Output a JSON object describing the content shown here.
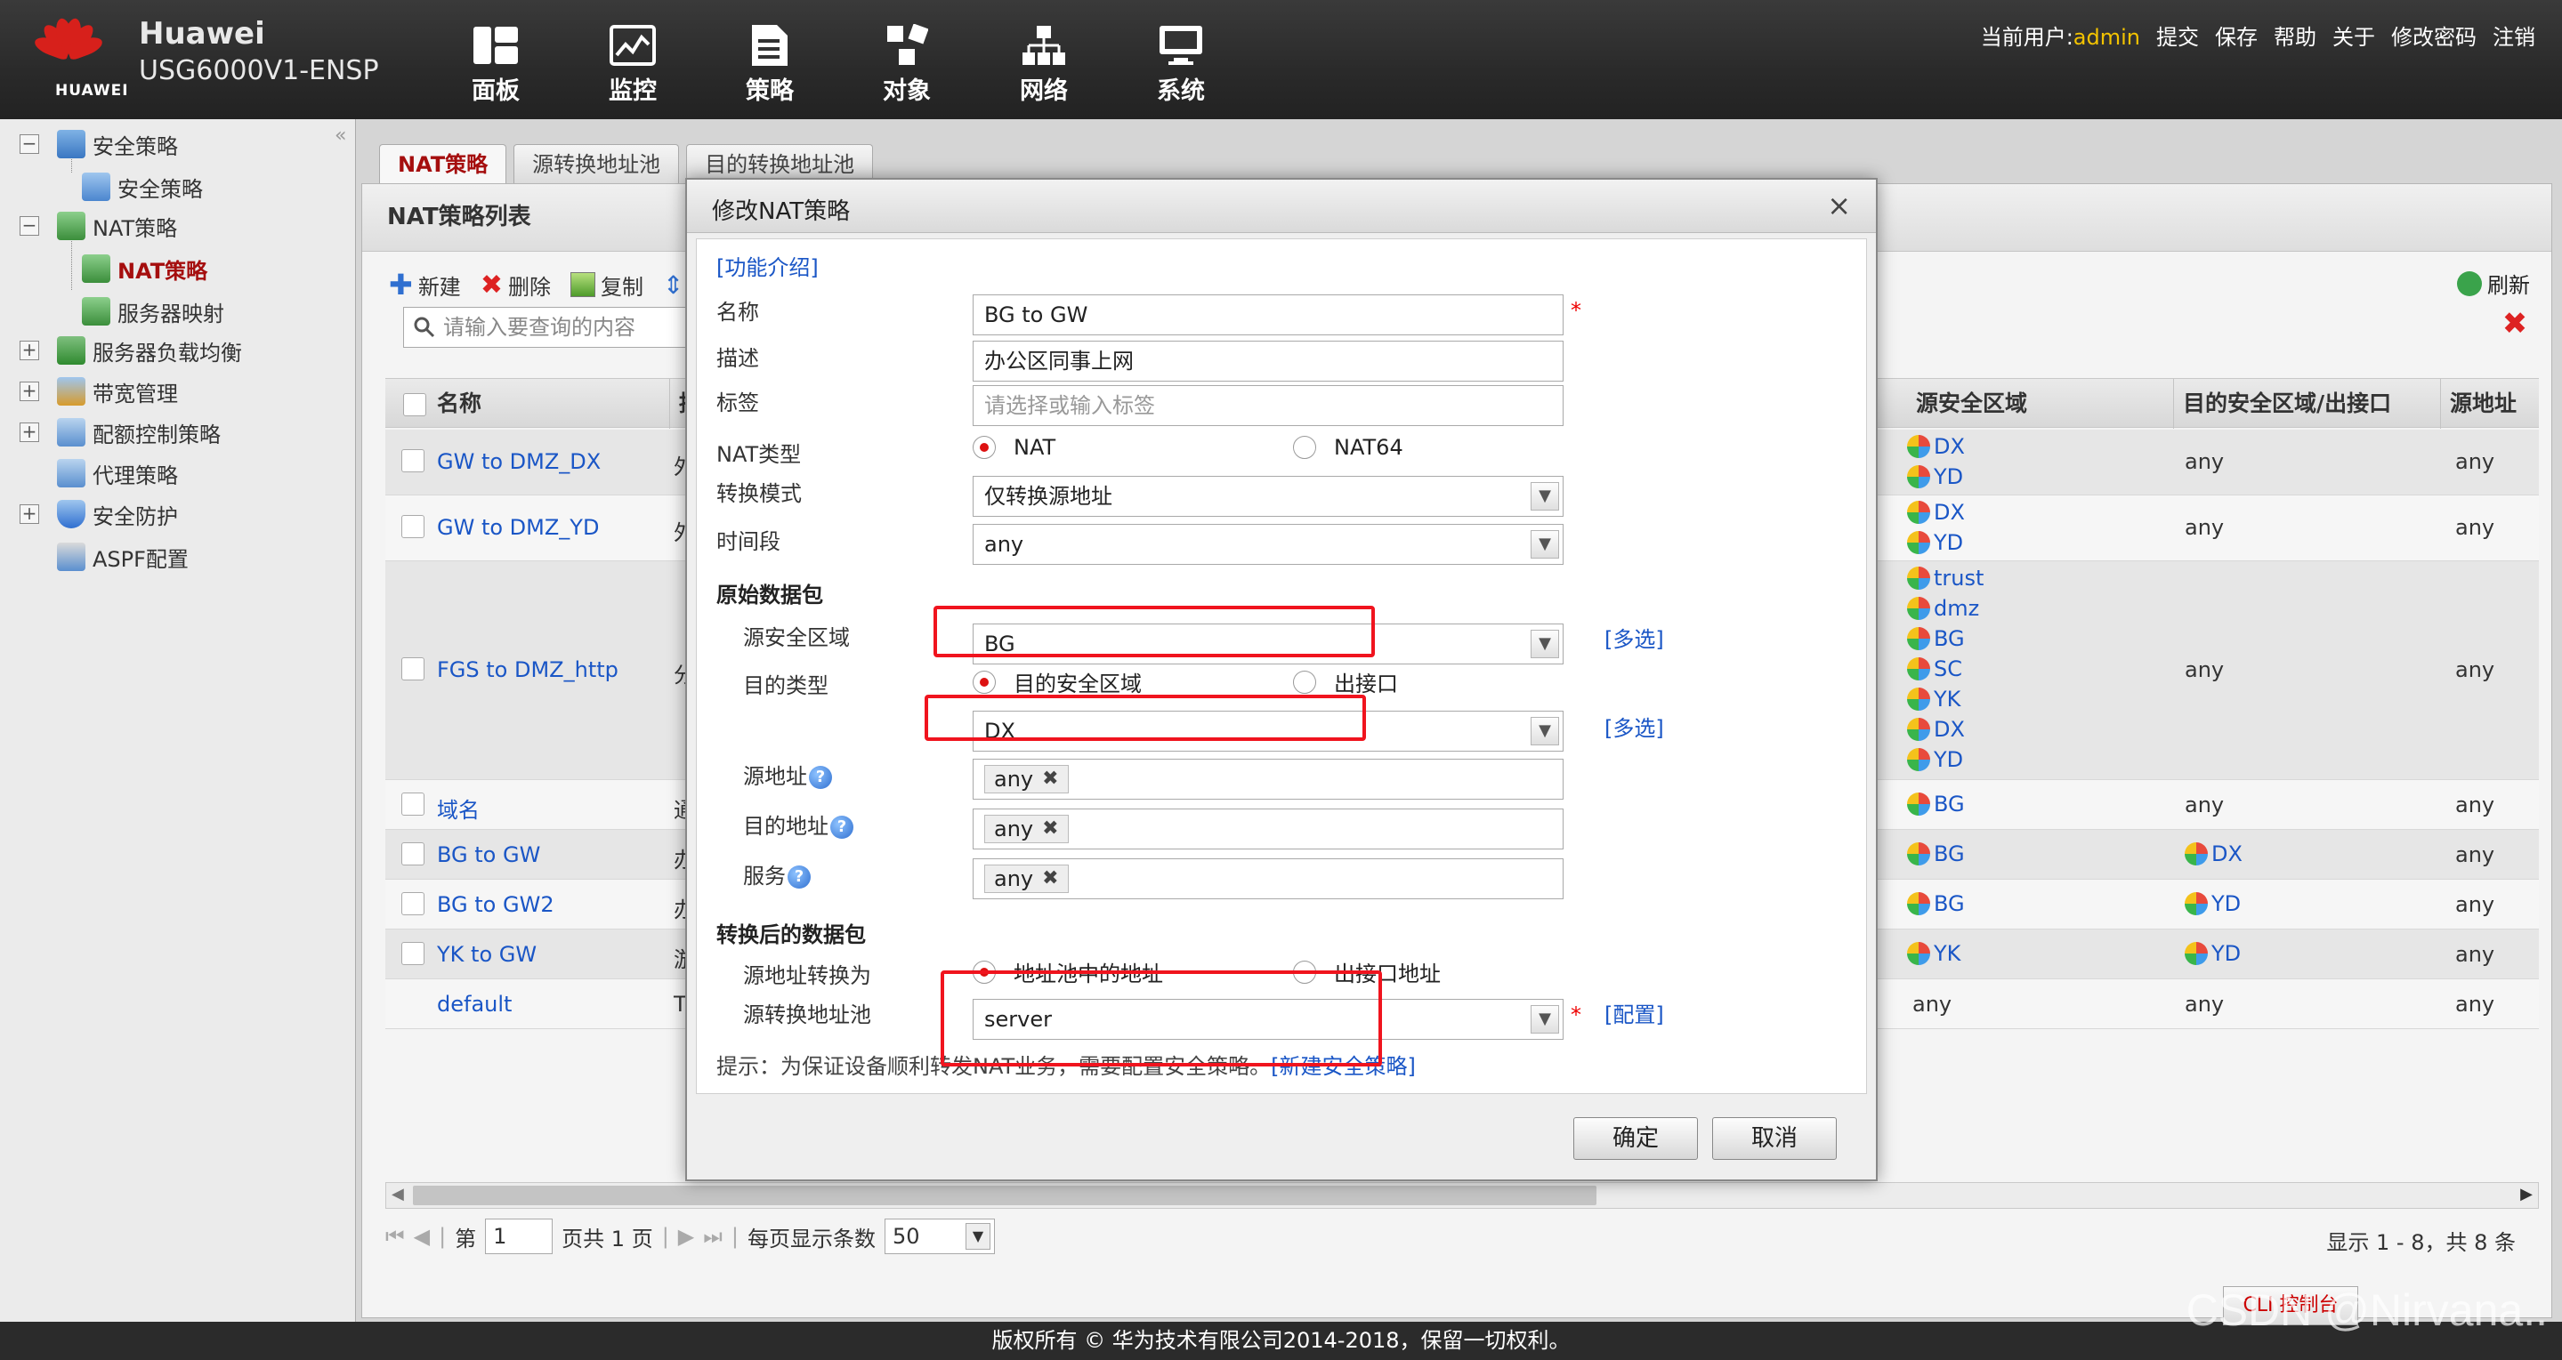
{
  "header": {
    "logo_text": "HUAWEI",
    "brand_name": "Huawei",
    "device_model": "USG6000V1-ENSP",
    "nav": [
      {
        "label": "面板",
        "icon": "dashboard-icon"
      },
      {
        "label": "监控",
        "icon": "monitor-icon"
      },
      {
        "label": "策略",
        "icon": "policy-icon"
      },
      {
        "label": "对象",
        "icon": "object-icon"
      },
      {
        "label": "网络",
        "icon": "network-icon"
      },
      {
        "label": "系统",
        "icon": "system-icon"
      }
    ],
    "user_prefix": "当前用户:",
    "user_name": "admin",
    "actions": [
      "提交",
      "保存",
      "帮助",
      "关于",
      "修改密码",
      "注销"
    ]
  },
  "sidebar": {
    "items": [
      {
        "label": "安全策略",
        "level": 0,
        "toggle": "−"
      },
      {
        "label": "安全策略",
        "level": 1
      },
      {
        "label": "NAT策略",
        "level": 0,
        "toggle": "−"
      },
      {
        "label": "NAT策略",
        "level": 1,
        "active": true
      },
      {
        "label": "服务器映射",
        "level": 1
      },
      {
        "label": "服务器负载均衡",
        "level": 0,
        "toggle": "+"
      },
      {
        "label": "带宽管理",
        "level": 0,
        "toggle": "+"
      },
      {
        "label": "配额控制策略",
        "level": 0,
        "toggle": "+"
      },
      {
        "label": "代理策略",
        "level": 0
      },
      {
        "label": "安全防护",
        "level": 0,
        "toggle": "+"
      },
      {
        "label": "ASPF配置",
        "level": 0
      }
    ]
  },
  "tabs": [
    {
      "label": "NAT策略",
      "active": true
    },
    {
      "label": "源转换地址池"
    },
    {
      "label": "目的转换地址池"
    }
  ],
  "panel": {
    "title": "NAT策略列表",
    "toolbar": {
      "new": "新建",
      "delete": "删除",
      "copy": "复制",
      "more": "移"
    },
    "refresh": "刷新",
    "search_placeholder": "请输入要查询的内容"
  },
  "table": {
    "headers": {
      "name": "名称",
      "desc": "描",
      "src_zone": "源安全区域",
      "dst_zone": "目的安全区域/出接口",
      "src_addr": "源地址"
    },
    "rows": [
      {
        "name": "GW to DMZ_DX",
        "desc": "外",
        "src_zones": [
          "DX",
          "YD"
        ],
        "dst": "any",
        "src_addr": "any"
      },
      {
        "name": "GW to DMZ_YD",
        "desc": "外",
        "src_zones": [
          "DX",
          "YD"
        ],
        "dst": "any",
        "src_addr": "any"
      },
      {
        "name": "FGS to DMZ_http",
        "desc": "分",
        "src_zones": [
          "trust",
          "dmz",
          "BG",
          "SC",
          "YK",
          "DX",
          "YD"
        ],
        "dst": "any",
        "src_addr": "any"
      },
      {
        "name": "域名",
        "desc": "通",
        "src_zones": [
          "BG"
        ],
        "dst": "any",
        "src_addr": "any"
      },
      {
        "name": "BG to GW",
        "desc": "办",
        "src_zones": [
          "BG"
        ],
        "dst_zone": "DX",
        "src_addr": "any"
      },
      {
        "name": "BG to GW2",
        "desc": "办",
        "src_zones": [
          "BG"
        ],
        "dst_zone": "YD",
        "src_addr": "any"
      },
      {
        "name": "YK to GW",
        "desc": "游",
        "src_zones": [
          "YK"
        ],
        "dst_zone": "YD",
        "src_addr": "any"
      },
      {
        "name": "default",
        "desc": "Th",
        "src_text": "any",
        "dst": "any",
        "src_addr": "any"
      }
    ]
  },
  "pager": {
    "page_prefix": "第",
    "page_value": "1",
    "page_suffix": "页共 1 页",
    "per_page_label": "每页显示条数",
    "per_page_value": "50",
    "info": "显示 1 - 8，共 8 条"
  },
  "modal": {
    "title": "修改NAT策略",
    "close": "×",
    "intro_link": "[功能介绍]",
    "labels": {
      "name": "名称",
      "desc": "描述",
      "tag": "标签",
      "nat_type": "NAT类型",
      "mode": "转换模式",
      "time": "时间段",
      "orig_section": "原始数据包",
      "src_zone": "源安全区域",
      "dst_type": "目的类型",
      "src_addr": "源地址",
      "dst_addr": "目的地址",
      "service": "服务",
      "trans_section": "转换后的数据包",
      "src_trans": "源地址转换为",
      "src_pool": "源转换地址池"
    },
    "values": {
      "name": "BG to GW",
      "desc": "办公区同事上网",
      "tag_placeholder": "请选择或输入标签",
      "nat_type_opt1": "NAT",
      "nat_type_opt2": "NAT64",
      "mode": "仅转换源地址",
      "time": "any",
      "src_zone": "BG",
      "dst_type_opt1": "目的安全区域",
      "dst_type_opt2": "出接口",
      "dst_zone": "DX",
      "src_addr_tag": "any",
      "dst_addr_tag": "any",
      "service_tag": "any",
      "src_trans_opt1": "地址池中的地址",
      "src_trans_opt2": "出接口地址",
      "src_pool": "server"
    },
    "multi_select": "[多选]",
    "config_link": "[配置]",
    "hint_text": "提示：为保证设备顺利转发NAT业务，需要配置安全策略。",
    "hint_link": "[新建安全策略]",
    "ok": "确定",
    "cancel": "取消"
  },
  "footer": {
    "copyright": "版权所有 © 华为技术有限公司2014-2018，保留一切权利。",
    "cli": "CLI 控制台",
    "watermark": "CSDN @Nirvana.."
  },
  "colors": {
    "highlight_box": "#f0141e",
    "link": "#1a56c6",
    "active_tab": "#a50e0e"
  }
}
